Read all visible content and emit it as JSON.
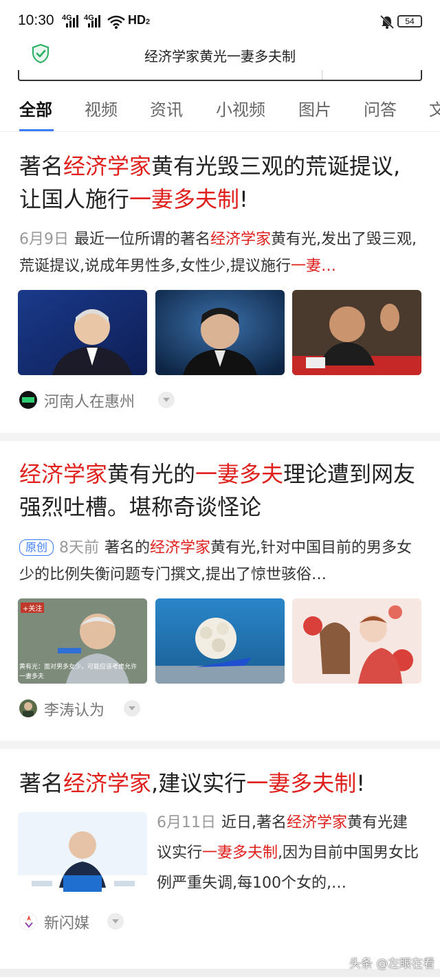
{
  "status_bar": {
    "time": "10:30",
    "signal_1": "4G",
    "signal_2": "4G",
    "hd": "HD",
    "hd_sub": "2",
    "battery": "54"
  },
  "header": {
    "title": "经济学家黄光一妻多夫制"
  },
  "tabs": [
    {
      "label": "全部",
      "active": true
    },
    {
      "label": "视频"
    },
    {
      "label": "资讯"
    },
    {
      "label": "小视频"
    },
    {
      "label": "图片"
    },
    {
      "label": "问答"
    },
    {
      "label": "文"
    }
  ],
  "results": [
    {
      "title_parts": [
        "著名",
        "经济学家",
        "黄有光毁三观的荒诞提议,",
        "让国人施行",
        "一妻多夫制",
        "!"
      ],
      "date": "6月9日",
      "snippet_parts": [
        "最近一位所谓的著名",
        "经济学家",
        "黄有光,发出了毁三观,荒诞提议,说成年男性多,女性少,提议施行",
        "一妻…"
      ],
      "author": "河南人在惠州"
    },
    {
      "title_parts": [
        "经济学家",
        "黄有光的",
        "一妻多夫",
        "理论遭到网友强烈吐槽。堪称奇谈怪论"
      ],
      "badge": "原创",
      "date": "8天前",
      "snippet_parts": [
        "著名的",
        "经济学家",
        "黄有光,针对中国目前的男多女少的比例失衡问题专门撰文,提出了惊世骇俗…"
      ],
      "author": "李涛认为",
      "thumb_caption_1": "黄有光：面对男多女少，可能应该考虑允许",
      "thumb_caption_2": "一妻多夫",
      "thumb_tag": "+关注"
    },
    {
      "title_parts": [
        "著名",
        "经济学家",
        ",建议实行",
        "一妻多夫制",
        "!"
      ],
      "date": "6月11日",
      "snippet_parts": [
        "近日,著名",
        "经济学家",
        "黄有光建议实行",
        "一妻多夫制",
        ",因为目前中国男女比例严重失调,每100个女的,…"
      ],
      "author": "新闪媒"
    }
  ],
  "watermark": "头条 @左眼在看",
  "colors": {
    "highlight": "#e0201c",
    "accent": "#3b7cff",
    "separator": "#f3f3f3"
  },
  "icons": [
    "shield-check-icon",
    "wifi-icon",
    "mute-bell-icon",
    "battery-icon",
    "chevron-down-icon"
  ]
}
